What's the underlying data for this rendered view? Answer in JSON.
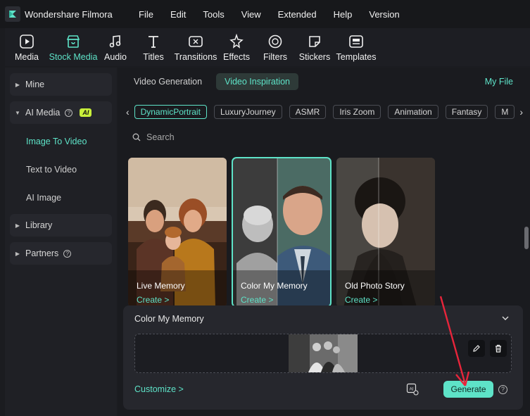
{
  "app": {
    "title": "Wondershare Filmora",
    "logo_icon": "filmora-logo-icon"
  },
  "menu": [
    "File",
    "Edit",
    "Tools",
    "View",
    "Extended",
    "Help",
    "Version"
  ],
  "toolbar": [
    {
      "label": "Media",
      "icon": "media-icon",
      "active": false
    },
    {
      "label": "Stock Media",
      "icon": "stock-media-icon",
      "active": true
    },
    {
      "label": "Audio",
      "icon": "music-note-icon",
      "active": false
    },
    {
      "label": "Titles",
      "icon": "text-t-icon",
      "active": false
    },
    {
      "label": "Transitions",
      "icon": "transitions-icon",
      "active": false
    },
    {
      "label": "Effects",
      "icon": "effects-icon",
      "active": false
    },
    {
      "label": "Filters",
      "icon": "filters-icon",
      "active": false
    },
    {
      "label": "Stickers",
      "icon": "stickers-icon",
      "active": false
    },
    {
      "label": "Templates",
      "icon": "templates-icon",
      "active": false
    }
  ],
  "sidebar": {
    "mine": "Mine",
    "ai_media": "AI Media",
    "ai_badge": "AI",
    "image_to_video": "Image To Video",
    "text_to_video": "Text to Video",
    "ai_image": "AI Image",
    "library": "Library",
    "partners": "Partners",
    "help_glyph": "?"
  },
  "main": {
    "tabs": [
      "Video Generation",
      "Video Inspiration"
    ],
    "active_tab": "Video Inspiration",
    "my_file": "My File",
    "chips": [
      "DynamicPortrait",
      "LuxuryJourney",
      "ASMR",
      "Iris Zoom",
      "Animation",
      "Fantasy",
      "M"
    ],
    "active_chip": "DynamicPortrait",
    "search_placeholder": "Search",
    "cards": [
      {
        "title": "Live Memory",
        "action": "Create >"
      },
      {
        "title": "Color My Memory",
        "action": "Create >"
      },
      {
        "title": "Old Photo Story",
        "action": "Create >"
      }
    ]
  },
  "panel": {
    "title": "Color My Memory",
    "customize": "Customize >",
    "generate": "Generate",
    "help_glyph": "?"
  },
  "colors": {
    "accent": "#5ee3c8",
    "annotation_arrow": "#e8253b",
    "ai_badge": "#c8f03a"
  }
}
